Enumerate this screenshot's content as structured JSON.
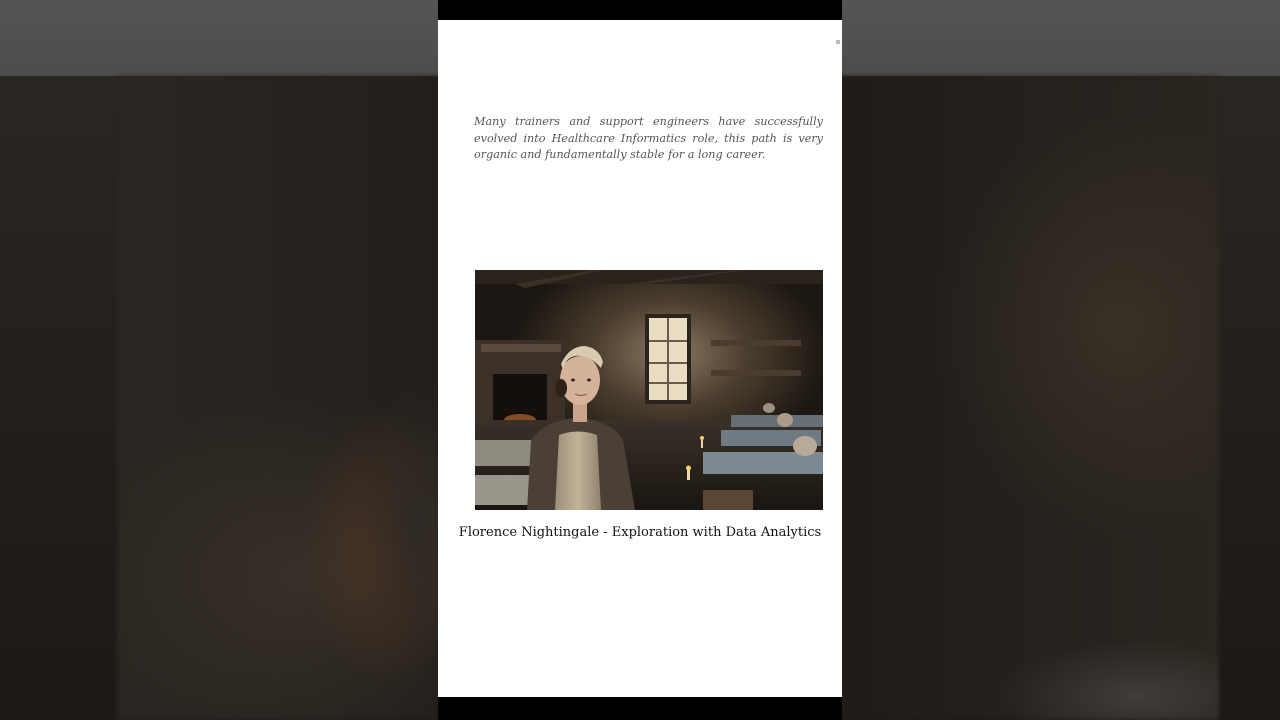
{
  "article": {
    "intro_text": "Many trainers and support engineers have successfully evolved into Healthcare Informatics role, this path is very organic and fundamentally stable for a long career.",
    "caption": "Florence Nightingale - Exploration with Data Analytics"
  },
  "colors": {
    "page_background": "#ffffff",
    "viewport_bar": "#000000",
    "body_text": "#555555",
    "caption_text": "#111111"
  }
}
